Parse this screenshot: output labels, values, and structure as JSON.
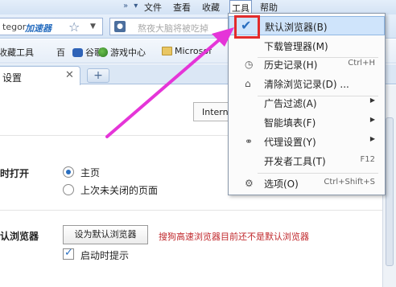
{
  "menubar": {
    "file": "文件",
    "view": "查看",
    "favorites": "收藏",
    "tools": "工具",
    "help": "帮助"
  },
  "toolbar": {
    "address_text": "tegor",
    "address_badge": "加速器",
    "search_placeholder": "熬夜大脑将被吃掉"
  },
  "favbar": {
    "collect": "收藏工具",
    "hundred": "百",
    "google": "谷歌",
    "games": "游戏中心",
    "microsoft": "Microsof"
  },
  "tabs": [
    {
      "label": "设置"
    }
  ],
  "content": {
    "engine_select": "Intern",
    "startup_label": "时打开",
    "startup_options": [
      "主页",
      "上次未关闭的页面"
    ],
    "default_label": "认浏览器",
    "set_default_button": "设为默认浏览器",
    "warning": "搜狗高速浏览器目前还不是默认浏览器",
    "startup_prompt": "启动时提示"
  },
  "tools_menu": {
    "items": [
      {
        "label": "默认浏览器(B)",
        "shortcut": "",
        "submenu": false,
        "icon": "check-icon"
      },
      {
        "label": "下载管理器(M)",
        "shortcut": "",
        "submenu": false,
        "icon": ""
      },
      {
        "label": "历史记录(H)",
        "shortcut": "Ctrl+H",
        "submenu": false,
        "icon": "clock-icon"
      },
      {
        "label": "清除浏览记录(D) ...",
        "shortcut": "",
        "submenu": false,
        "icon": "eraser-icon"
      },
      {
        "label": "广告过滤(A)",
        "shortcut": "",
        "submenu": true,
        "icon": ""
      },
      {
        "label": "智能填表(F)",
        "shortcut": "",
        "submenu": true,
        "icon": ""
      },
      {
        "label": "代理设置(Y)",
        "shortcut": "",
        "submenu": true,
        "icon": "link-icon"
      },
      {
        "label": "开发者工具(T)",
        "shortcut": "F12",
        "submenu": false,
        "icon": ""
      },
      {
        "label": "选项(O)",
        "shortcut": "Ctrl+Shift+S",
        "submenu": false,
        "icon": "gear-icon"
      }
    ]
  },
  "colors": {
    "accent": "#2a6fc0",
    "highlight": "#cfe4fb",
    "annotation_red": "#e22b2b",
    "annotation_magenta": "#e535d8",
    "warning_text": "#c0282c"
  }
}
